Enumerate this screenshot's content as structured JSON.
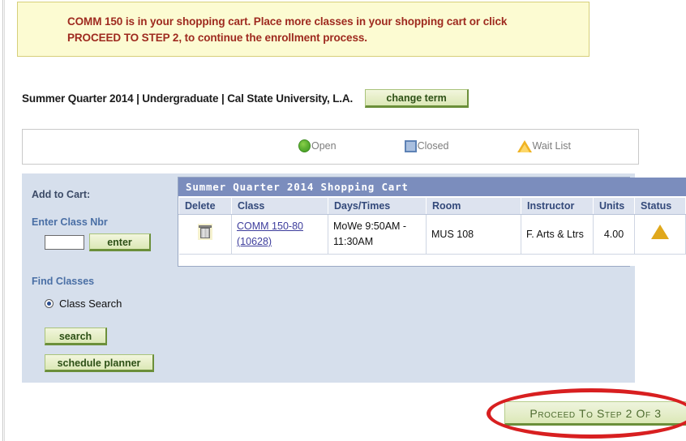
{
  "alert": {
    "message": "COMM  150 is in your shopping cart. Place more classes in your shopping cart or click PROCEED TO STEP 2, to continue the enrollment process."
  },
  "term_bar": {
    "term_text": "Summer Quarter 2014 | Undergraduate | Cal State University, L.A.",
    "change_term_label": "change term"
  },
  "legend": {
    "open_label": "Open",
    "closed_label": "Closed",
    "waitlist_label": "Wait List",
    "open_icon": "green-circle-icon",
    "closed_icon": "blue-square-icon",
    "waitlist_icon": "orange-triangle-icon",
    "colors": {
      "open": "#4fa828",
      "closed": "#5e82b5",
      "waitlist": "#f0b323"
    }
  },
  "add_to_cart": {
    "heading": "Add to Cart:",
    "enter_class_nbr_label": "Enter Class Nbr",
    "class_nbr_value": "",
    "class_nbr_placeholder": "",
    "enter_button_label": "enter",
    "find_classes_label": "Find Classes",
    "class_search_label": "Class Search",
    "class_search_selected": true,
    "search_button_label": "search",
    "schedule_planner_button_label": "schedule planner"
  },
  "cart": {
    "caption": "Summer Quarter 2014 Shopping Cart",
    "columns": [
      "Delete",
      "Class",
      "Days/Times",
      "Room",
      "Instructor",
      "Units",
      "Status"
    ],
    "rows": [
      {
        "delete_icon": "trash-icon",
        "class_name": "COMM 150-80",
        "class_nbr": "(10628)",
        "days_times": "MoWe 9:50AM - 11:30AM",
        "room": "MUS 108",
        "instructor": "F. Arts & Ltrs",
        "units": "4.00",
        "status_icon": "orange-triangle-icon"
      }
    ]
  },
  "footer": {
    "proceed_label": "Proceed To Step 2 Of 3",
    "annotation_color": "#d81f20"
  }
}
